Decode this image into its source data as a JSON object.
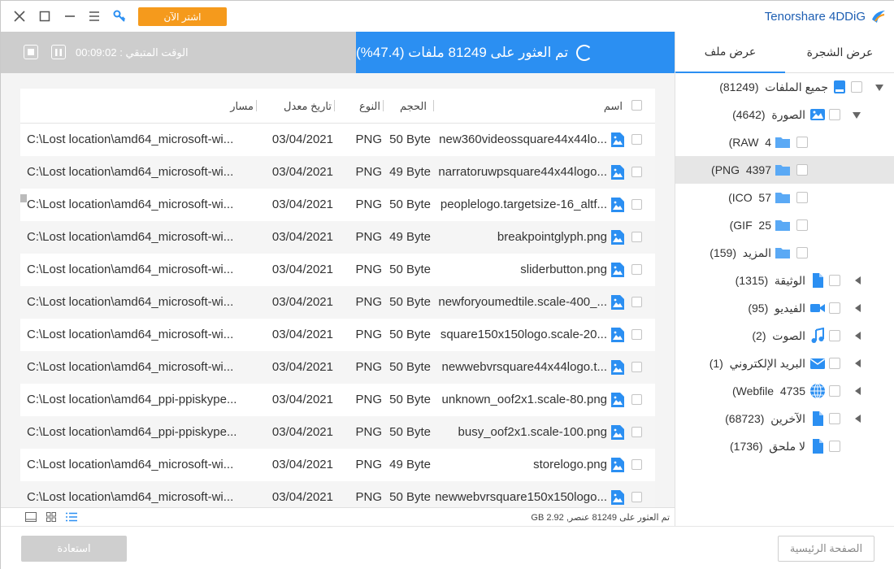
{
  "titlebar": {
    "buy_label": "اشتر الآن",
    "brand": "Tenorshare 4DDiG"
  },
  "status": {
    "scan_text": "تم العثور على 81249 ملفات (47.4%)",
    "remaining_label": "الوقت المتبقي : 00:09:02"
  },
  "sidebar": {
    "tab_tree": "عرض الشجرة",
    "tab_file": "عرض ملف",
    "items": [
      {
        "label": "جميع الملفات",
        "count": "(81249)",
        "icon": "drive-icon"
      },
      {
        "label": "الصورة",
        "count": "(4642)",
        "icon": "image-icon"
      },
      {
        "label": "RAW",
        "count": "4)",
        "icon": "folder-icon"
      },
      {
        "label": "PNG",
        "count": "4397)",
        "icon": "folder-icon"
      },
      {
        "label": "ICO",
        "count": "57)",
        "icon": "folder-icon"
      },
      {
        "label": "GIF",
        "count": "25)",
        "icon": "folder-icon"
      },
      {
        "label": "المزيد",
        "count": "(159)",
        "icon": "folder-icon"
      },
      {
        "label": "الوثيقة",
        "count": "(1315)",
        "icon": "document-icon"
      },
      {
        "label": "الفيديو",
        "count": "(95)",
        "icon": "video-icon"
      },
      {
        "label": "الصوت",
        "count": "(2)",
        "icon": "music-icon"
      },
      {
        "label": "البريد الإلكتروني",
        "count": "(1)",
        "icon": "mail-icon"
      },
      {
        "label": "Webfile",
        "count": "4735)",
        "icon": "globe-icon"
      },
      {
        "label": "الآخرين",
        "count": "(68723)",
        "icon": "document-icon"
      },
      {
        "label": "لا ملحق",
        "count": "(1736)",
        "icon": "document-icon"
      }
    ]
  },
  "table": {
    "headers": {
      "name": "اسم",
      "size": "الحجم",
      "type": "النوع",
      "date": "تاريخ معدل",
      "path": "مسار"
    },
    "rows": [
      {
        "name": "new360videossquare44x44lo...",
        "size": "50 Byte",
        "type": "PNG",
        "date": "03/04/2021",
        "path": "C:\\Lost location\\amd64_microsoft-wi..."
      },
      {
        "name": "narratoruwpsquare44x44logo...",
        "size": "49 Byte",
        "type": "PNG",
        "date": "03/04/2021",
        "path": "C:\\Lost location\\amd64_microsoft-wi..."
      },
      {
        "name": "peoplelogo.targetsize-16_altf...",
        "size": "50 Byte",
        "type": "PNG",
        "date": "03/04/2021",
        "path": "C:\\Lost location\\amd64_microsoft-wi..."
      },
      {
        "name": "breakpointglyph.png",
        "size": "49 Byte",
        "type": "PNG",
        "date": "03/04/2021",
        "path": "C:\\Lost location\\amd64_microsoft-wi..."
      },
      {
        "name": "sliderbutton.png",
        "size": "50 Byte",
        "type": "PNG",
        "date": "03/04/2021",
        "path": "C:\\Lost location\\amd64_microsoft-wi..."
      },
      {
        "name": "newforyoumedtile.scale-400_...",
        "size": "50 Byte",
        "type": "PNG",
        "date": "03/04/2021",
        "path": "C:\\Lost location\\amd64_microsoft-wi..."
      },
      {
        "name": "square150x150logo.scale-20...",
        "size": "50 Byte",
        "type": "PNG",
        "date": "03/04/2021",
        "path": "C:\\Lost location\\amd64_microsoft-wi..."
      },
      {
        "name": "newwebvrsquare44x44logo.t...",
        "size": "50 Byte",
        "type": "PNG",
        "date": "03/04/2021",
        "path": "C:\\Lost location\\amd64_microsoft-wi..."
      },
      {
        "name": "unknown_oof2x1.scale-80.png",
        "size": "50 Byte",
        "type": "PNG",
        "date": "03/04/2021",
        "path": "C:\\Lost location\\amd64_ppi-ppiskype..."
      },
      {
        "name": "busy_oof2x1.scale-100.png",
        "size": "50 Byte",
        "type": "PNG",
        "date": "03/04/2021",
        "path": "C:\\Lost location\\amd64_ppi-ppiskype..."
      },
      {
        "name": "storelogo.png",
        "size": "49 Byte",
        "type": "PNG",
        "date": "03/04/2021",
        "path": "C:\\Lost location\\amd64_microsoft-wi..."
      },
      {
        "name": "newwebvrsquare150x150logo...",
        "size": "50 Byte",
        "type": "PNG",
        "date": "03/04/2021",
        "path": "C:\\Lost location\\amd64_microsoft-wi..."
      }
    ]
  },
  "infobar": {
    "text": "تم العثور على 81249 عنصر, 2.92 GB"
  },
  "footer": {
    "recover_label": "استعادة",
    "home_label": "الصفحة الرئيسية"
  },
  "colors": {
    "accent": "#2b8ff2",
    "buy": "#f59a1c",
    "status_gray": "#cdcdcd"
  }
}
